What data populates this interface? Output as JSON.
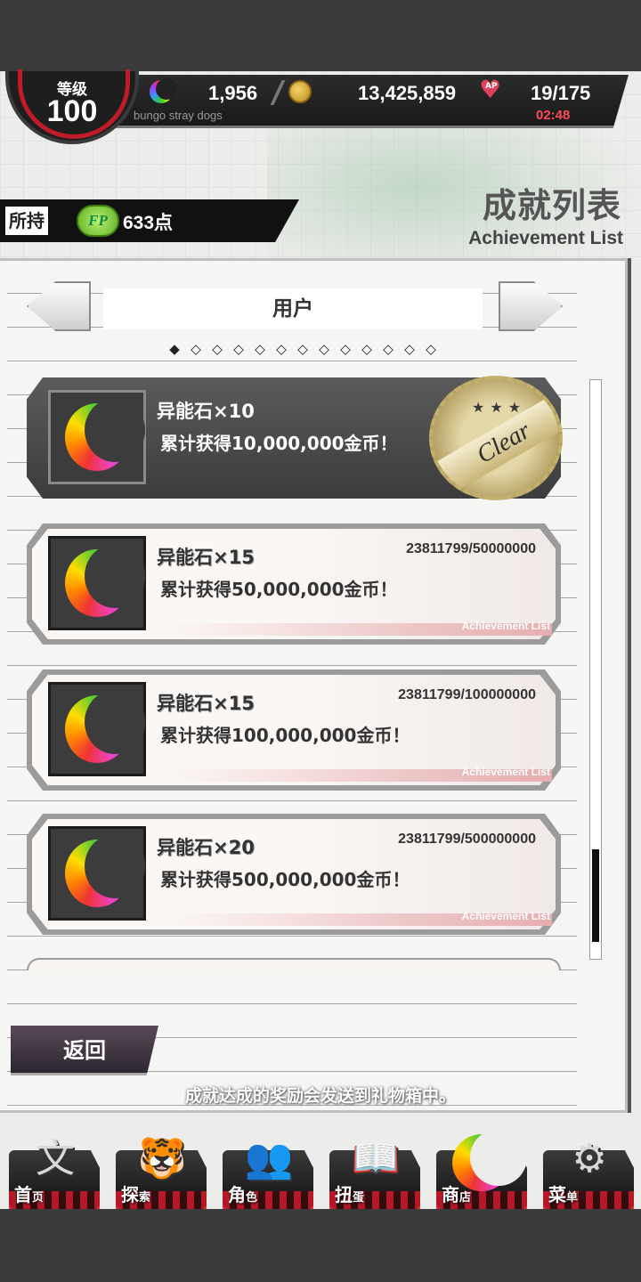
{
  "status": {
    "level_label": "等级",
    "level": "100",
    "stones": "1,956",
    "coins": "13,425,859",
    "ap": "19/175",
    "ap_timer": "02:48",
    "subtitle": "bungo stray dogs",
    "ap_icon_text": "AP"
  },
  "fp": {
    "owned_label": "所持",
    "badge": "FP",
    "points": "633点"
  },
  "header": {
    "title_cn": "成就列表",
    "title_en": "Achievement List"
  },
  "category": {
    "label": "用户",
    "page_dots": [
      "◆",
      "◇",
      "◇",
      "◇",
      "◇",
      "◇",
      "◇",
      "◇",
      "◇",
      "◇",
      "◇",
      "◇",
      "◇"
    ]
  },
  "achievements": [
    {
      "reward": "异能石×10",
      "desc": "累计获得10,000,000金币！",
      "progress": "",
      "status": "clear",
      "seal_text": "Clear",
      "seal_stars": "★★★"
    },
    {
      "reward": "异能石×15",
      "desc": "累计获得50,000,000金币！",
      "progress": "23811799/50000000",
      "status": "open",
      "tag": "Achievement List"
    },
    {
      "reward": "异能石×15",
      "desc": "累计获得100,000,000金币！",
      "progress": "23811799/100000000",
      "status": "open",
      "tag": "Achievement List"
    },
    {
      "reward": "异能石×20",
      "desc": "累计获得500,000,000金币！",
      "progress": "23811799/500000000",
      "status": "open",
      "tag": "Achievement List"
    }
  ],
  "back_label": "返回",
  "notice": "成就达成的奖励会发送到礼物箱中。",
  "nav": [
    {
      "label": "首",
      "small": "页",
      "icon": "bungo-logo-icon",
      "glyph": "文"
    },
    {
      "label": "探",
      "small": "索",
      "icon": "tiger-icon",
      "glyph": "🐯"
    },
    {
      "label": "角",
      "small": "色",
      "icon": "characters-icon",
      "glyph": "👥"
    },
    {
      "label": "扭",
      "small": "蛋",
      "icon": "book-icon",
      "glyph": "📖"
    },
    {
      "label": "商",
      "small": "店",
      "icon": "moon-stone-icon",
      "glyph": ""
    },
    {
      "label": "菜",
      "small": "单",
      "icon": "gear-icon",
      "glyph": "⚙"
    }
  ]
}
